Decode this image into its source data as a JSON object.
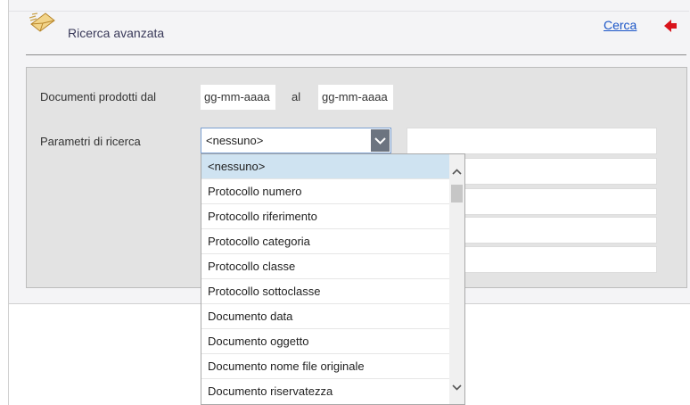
{
  "header": {
    "title": "Ricerca avanzata",
    "search_link": "Cerca",
    "icon": "envelope-icon",
    "back_icon": "red-arrow-left-icon"
  },
  "form": {
    "date_range_label": "Documenti prodotti dal",
    "date_from_placeholder": "gg-mm-aaaa",
    "to_label": "al",
    "date_to_placeholder": "gg-mm-aaaa",
    "search_params_label": "Parametri di ricerca",
    "select_value": "<nessuno>"
  },
  "dropdown": {
    "options": [
      "<nessuno>",
      "Protocollo numero",
      "Protocollo riferimento",
      "Protocollo categoria",
      "Protocollo classe",
      "Protocollo sottoclasse",
      "Documento data",
      "Documento oggetto",
      "Documento nome file originale",
      "Documento riservatezza"
    ],
    "selected_index": 0
  },
  "colors": {
    "link": "#1a55c7",
    "accent_red": "#d9141c",
    "selected_option": "#cfe3f1",
    "panel": "#e3e3e3"
  }
}
